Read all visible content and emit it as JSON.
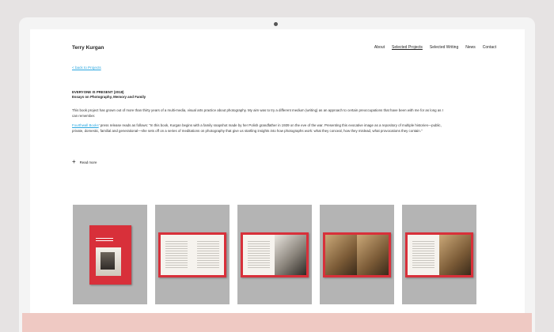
{
  "site": {
    "brand": "Terry Kurgan"
  },
  "nav": {
    "items": [
      {
        "label": "About",
        "active": false
      },
      {
        "label": "Selected Projects",
        "active": true
      },
      {
        "label": "Selected Writing",
        "active": false
      },
      {
        "label": "News",
        "active": false
      },
      {
        "label": "Contact",
        "active": false
      }
    ]
  },
  "content": {
    "back_link": "< back to Projects",
    "title": "EVERYONE IS PRESENT (2018)",
    "subtitle": "Essays on Photography, Memory and Family",
    "paragraph1": "This book project has grown out of more than thirty years of a multi-media, visual arts practice about photography. My aim was to try a different medium (writing) as an approach to certain preoccupations that have been with me for as long as I can remember.",
    "paragraph2_link": "Fourthwall Books",
    "paragraph2_rest": "' press release reads as follows: \"In this book, Kurgan begins with a family snapshot made by her Polish grandfather in 1939 on the eve of the war. Presenting this evocative image as a repository of multiple histories—public, private, domestic, familial and generational—she sets off on a series of meditations on photography that give us startling insights into how photographs work: what they conceal, how they mislead, what provocations they contain.\"",
    "read_more": "Read more"
  },
  "gallery": {
    "colors": {
      "tile_bg": "#b4b4b4",
      "book_red": "#d8303a"
    },
    "items": [
      {
        "kind": "cover"
      },
      {
        "kind": "text-spread"
      },
      {
        "kind": "text-photo-spread"
      },
      {
        "kind": "photo-spread"
      },
      {
        "kind": "text-sepia-spread"
      }
    ]
  }
}
